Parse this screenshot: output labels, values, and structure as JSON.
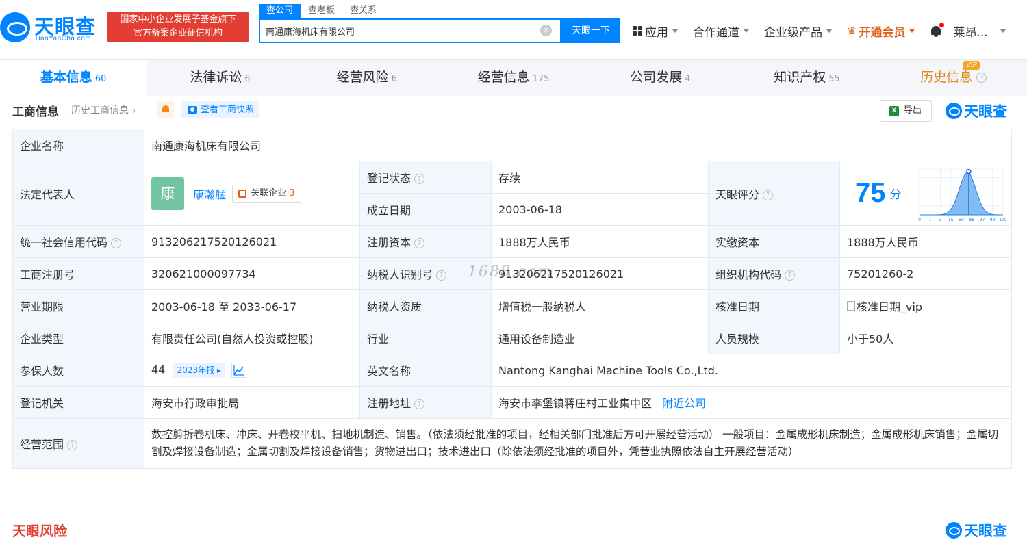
{
  "header": {
    "logo_text": "天眼查",
    "logo_sub": "TianYanCha.com",
    "slogan_line1": "国家中小企业发展子基金旗下",
    "slogan_line2": "官方备案企业征信机构",
    "search_tabs": [
      "查公司",
      "查老板",
      "查关系"
    ],
    "search_value": "南通康海机床有限公司",
    "search_button": "天眼一下",
    "nav": {
      "apps": "应用",
      "partner": "合作通道",
      "enterprise": "企业级产品",
      "vip": "开通会员",
      "user": "莱昂..."
    }
  },
  "tabs": [
    {
      "label": "基本信息",
      "count": "60"
    },
    {
      "label": "法律诉讼",
      "count": "6"
    },
    {
      "label": "经营风险",
      "count": "6"
    },
    {
      "label": "经营信息",
      "count": "175"
    },
    {
      "label": "公司发展",
      "count": "4"
    },
    {
      "label": "知识产权",
      "count": "55"
    },
    {
      "label": "历史信息",
      "count": ""
    }
  ],
  "vip_badge": "VIP",
  "section": {
    "title": "工商信息",
    "history": "历史工商信息",
    "snapshot": "查看工商快照",
    "export": "导出",
    "brand": "天眼查"
  },
  "info": {
    "company_name_label": "企业名称",
    "company_name": "南通康海机床有限公司",
    "legal_rep_label": "法定代表人",
    "legal_rep_avatar": "康",
    "legal_rep_name": "康瀚艋",
    "related_label": "关联企业",
    "related_count": "3",
    "status_label": "登记状态",
    "status": "存续",
    "founded_label": "成立日期",
    "founded": "2003-06-18",
    "score_label": "天眼评分",
    "score": "75",
    "score_unit": "分",
    "credit_code_label": "统一社会信用代码",
    "credit_code": "913206217520126021",
    "reg_capital_label": "注册资本",
    "reg_capital": "1888万人民币",
    "paid_capital_label": "实缴资本",
    "paid_capital": "1888万人民币",
    "reg_no_label": "工商注册号",
    "reg_no": "320621000097734",
    "taxpayer_id_label": "纳税人识别号",
    "taxpayer_id": "913206217520126021",
    "org_code_label": "组织机构代码",
    "org_code": "75201260-2",
    "term_label": "营业期限",
    "term": "2003-06-18 至 2033-06-17",
    "tax_qual_label": "纳税人资质",
    "tax_qual": "增值税一般纳税人",
    "approve_date_label": "核准日期",
    "approve_date_alt": "核准日期_vip",
    "type_label": "企业类型",
    "type": "有限责任公司(自然人投资或控股)",
    "industry_label": "行业",
    "industry": "通用设备制造业",
    "staff_size_label": "人员规模",
    "staff_size": "小于50人",
    "insured_label": "参保人数",
    "insured": "44",
    "insured_year": "2023年报",
    "english_name_label": "英文名称",
    "english_name": "Nantong Kanghai Machine Tools Co.,Ltd.",
    "authority_label": "登记机关",
    "authority": "海安市行政审批局",
    "address_label": "注册地址",
    "address": "海安市李堡镇蒋庄村工业集中区",
    "nearby": "附近公司",
    "scope_label": "经营范围",
    "scope": "数控剪折卷机床、冲床、开卷校平机、扫地机制造、销售。（依法须经批准的项目，经相关部门批准后方可开展经营活动） 一般项目：金属成形机床制造；金属成形机床销售；金属切割及焊接设备制造；金属切割及焊接设备销售；货物进出口；技术进出口（除依法须经批准的项目外，凭营业执照依法自主开展经营活动）"
  },
  "score_chart": {
    "ticks": [
      "0",
      "1",
      "3",
      "15",
      "50",
      "85",
      "97",
      "99",
      "100"
    ],
    "marker_value": 75
  },
  "watermark": "1688.com",
  "footer": {
    "risk": "天眼风险",
    "brand": "天眼查"
  }
}
